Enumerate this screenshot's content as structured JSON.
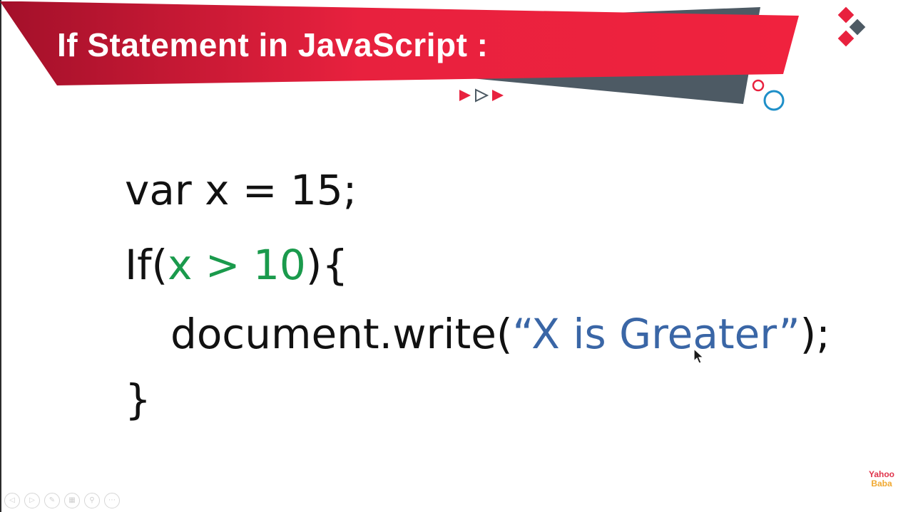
{
  "slide": {
    "title": "If Statement in JavaScript :"
  },
  "code": {
    "line1": "var x = 15;",
    "line2_keyword": "If(",
    "line2_condition": "x > 10",
    "line2_close": "){",
    "line3_call": "document.write(",
    "line3_string": "“X is Greater”",
    "line3_close": ");",
    "line4": "}"
  },
  "logo": {
    "line1": "Yahoo",
    "line2": "Baba"
  },
  "player_controls": [
    {
      "name": "previous-icon",
      "glyph": "◁"
    },
    {
      "name": "next-icon",
      "glyph": "▷"
    },
    {
      "name": "pen-icon",
      "glyph": "✎"
    },
    {
      "name": "slides-icon",
      "glyph": "▦"
    },
    {
      "name": "zoom-icon",
      "glyph": "⚲"
    },
    {
      "name": "more-icon",
      "glyph": "⋯"
    }
  ],
  "colors": {
    "banner_red": "#e8213e",
    "banner_dark_red": "#a3102a",
    "accent_gray": "#4d5a64",
    "condition_green": "#1a9a4c",
    "string_blue": "#3a66a6",
    "circle_blue": "#1e8fc8"
  }
}
